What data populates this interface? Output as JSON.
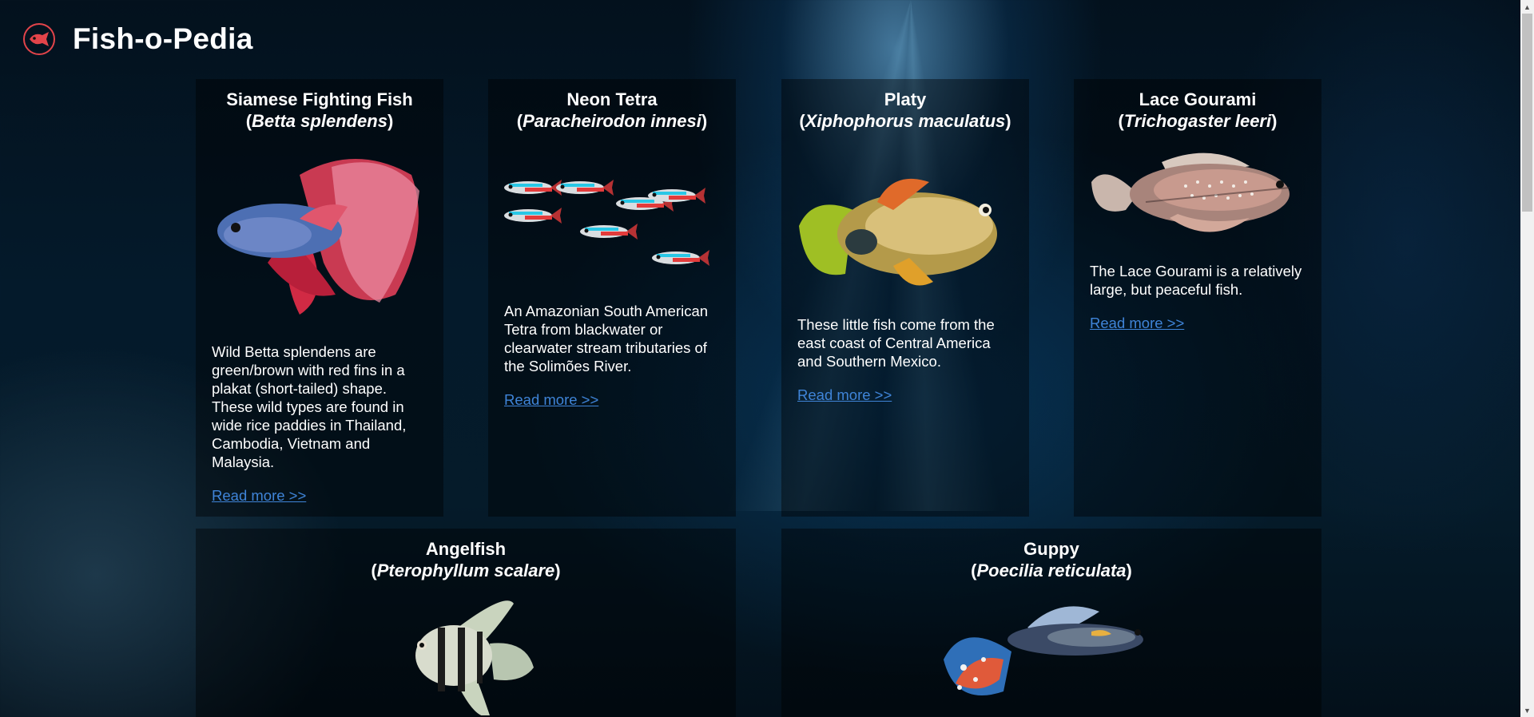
{
  "site": {
    "title": "Fish-o-Pedia",
    "logo_icon": "fish-icon",
    "accent": "#e2444a"
  },
  "fish": [
    {
      "name": "Siamese Fighting Fish",
      "scientific": "Betta splendens",
      "description": "Wild Betta splendens are green/brown with red fins in a plakat (short-tailed) shape. These wild types are found in wide rice paddies in Thailand, Cambodia, Vietnam and Malaysia.",
      "link": "Read more >>"
    },
    {
      "name": "Neon Tetra",
      "scientific": "Paracheirodon innesi",
      "description": "An Amazonian South American Tetra from blackwater or clearwater stream tributaries of the Solimões River.",
      "link": "Read more >>"
    },
    {
      "name": "Platy",
      "scientific": "Xiphophorus maculatus",
      "description": "These little fish come from the east coast of Central America and Southern Mexico.",
      "link": "Read more >>"
    },
    {
      "name": "Lace Gourami",
      "scientific": "Trichogaster leeri",
      "description": "The Lace Gourami is a relatively large, but peaceful fish.",
      "link": "Read more >>"
    },
    {
      "name": "Angelfish",
      "scientific": "Pterophyllum scalare"
    },
    {
      "name": "Guppy",
      "scientific": "Poecilia reticulata"
    }
  ],
  "colors": {
    "link": "#3f84d8",
    "card_bg": "rgba(0,0,0,0.42)"
  }
}
